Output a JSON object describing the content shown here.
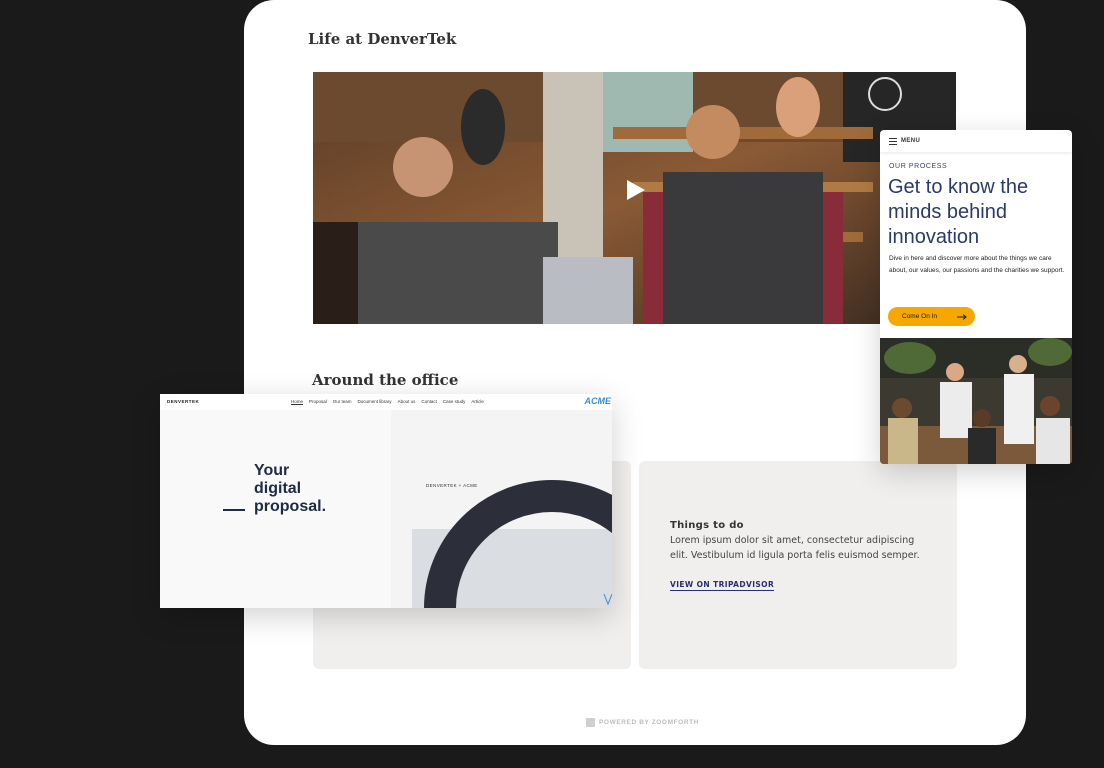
{
  "main": {
    "life_title": "Life at DenverTek",
    "office_title": "Around the office",
    "things": {
      "title": "Things to do",
      "body": "Lorem ipsum dolor sit amet, consectetur adipiscing elit. Vestibulum id ligula porta felis euismod semper.",
      "link": "VIEW ON TRIPADVISOR"
    },
    "powered": "POWERED BY ZOOMFORTH"
  },
  "proposal": {
    "brand": "DENVERTEK",
    "nav": [
      "Home",
      "Proposal",
      "Our team",
      "Document library",
      "About us",
      "Contact",
      "Case study",
      "Article"
    ],
    "acme": "ACME",
    "title_line1": "Your",
    "title_line2": "digital",
    "title_line3": "proposal.",
    "subtitle": "DENVERTEK + ACME"
  },
  "mobile": {
    "menu": "MENU",
    "eyebrow": "OUR PROCESS",
    "heading": "Get to know the minds behind innovation",
    "body": "Dive in here and discover more about the things we care about, our values, our passions and the charities we support.",
    "cta": "Come On In"
  },
  "colors": {
    "background": "#1a1a1a",
    "accent": "#f6a800",
    "navy": "#2b3a67"
  }
}
